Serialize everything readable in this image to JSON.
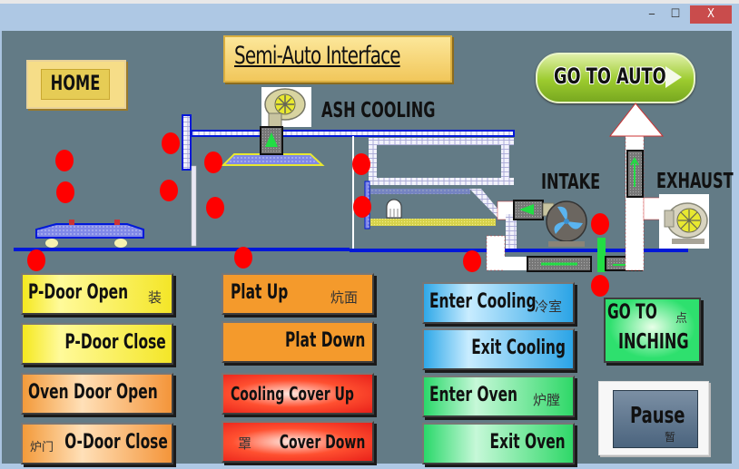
{
  "window": {
    "minimize_glyph": "‒",
    "maximize_glyph": "☐",
    "close_glyph": "X"
  },
  "header": {
    "title": "Semi-Auto Interface",
    "home_label": "HOME",
    "go_to_auto_label": "GO TO AUTO"
  },
  "diagram": {
    "ash_cooling_label": "ASH COOLING",
    "intake_label": "INTAKE",
    "exhaust_label": "EXHAUST",
    "indicator_color": "#ff0000",
    "rail_color": "#0018d8"
  },
  "buttons": {
    "p_door_open": {
      "label": "P-Door Open",
      "cn": "装"
    },
    "p_door_close": {
      "label": "P-Door Close"
    },
    "oven_door_open": {
      "label": "Oven Door Open"
    },
    "o_door_close": {
      "label": "O-Door Close",
      "cn": "炉门"
    },
    "plat_up": {
      "label": "Plat Up",
      "cn": "炕面"
    },
    "plat_down": {
      "label": "Plat Down"
    },
    "cooling_cover_up": {
      "label": "Cooling Cover Up"
    },
    "cover_down": {
      "label": "Cover Down",
      "cn": "罩"
    },
    "enter_cooling": {
      "label": "Enter Cooling",
      "cn": "冷室"
    },
    "exit_cooling": {
      "label": "Exit Cooling"
    },
    "enter_oven": {
      "label": "Enter Oven",
      "cn": "炉膛"
    },
    "exit_oven": {
      "label": "Exit Oven"
    },
    "go_to_inching": {
      "line1": "GO TO",
      "line2": "INCHING",
      "cn": "点"
    },
    "pause": {
      "label": "Pause",
      "cn": "暂"
    }
  }
}
